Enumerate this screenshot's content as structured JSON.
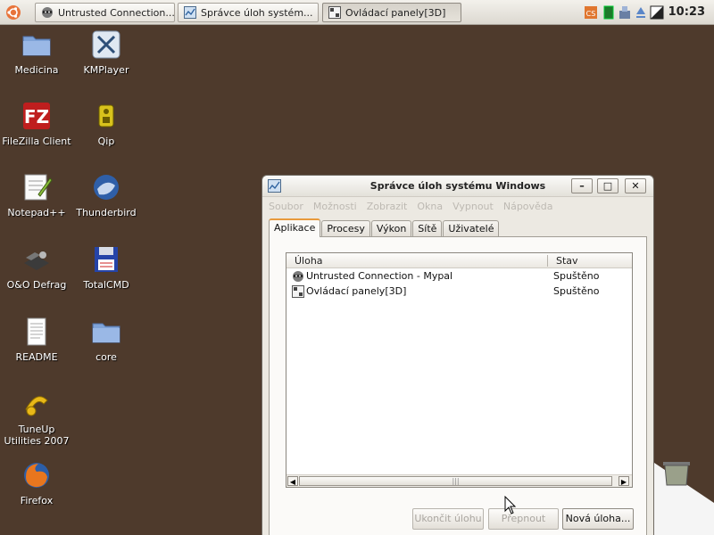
{
  "panel": {
    "tasks": [
      {
        "label": "Untrusted Connection..."
      },
      {
        "label": "Správce úloh systém..."
      },
      {
        "label": "Ovládací panely[3D]"
      }
    ],
    "clock": "10:23"
  },
  "desktop": {
    "icons": [
      {
        "label": "Medicina"
      },
      {
        "label": "KMPlayer"
      },
      {
        "label": "FileZilla Client"
      },
      {
        "label": "Qip"
      },
      {
        "label": "Notepad++"
      },
      {
        "label": "Thunderbird"
      },
      {
        "label": "O&O Defrag"
      },
      {
        "label": "TotalCMD"
      },
      {
        "label": "README"
      },
      {
        "label": "core"
      },
      {
        "label": "TuneUp Utilities 2007"
      },
      {
        "label": "Firefox"
      }
    ]
  },
  "taskmgr": {
    "title": "Správce úloh systému Windows",
    "menu": [
      "Soubor",
      "Možnosti",
      "Zobrazit",
      "Okna",
      "Vypnout",
      "Nápověda"
    ],
    "tabs": [
      "Aplikace",
      "Procesy",
      "Výkon",
      "Sítě",
      "Uživatelé"
    ],
    "columns": {
      "task": "Úloha",
      "status": "Stav"
    },
    "rows": [
      {
        "name": "Untrusted Connection - Mypal",
        "status": "Spuštěno"
      },
      {
        "name": "Ovládací panely[3D]",
        "status": "Spuštěno"
      }
    ],
    "buttons": {
      "end_task": "Ukončit úlohu",
      "switch_to": "Přepnout",
      "new_task": "Nová úloha..."
    }
  }
}
